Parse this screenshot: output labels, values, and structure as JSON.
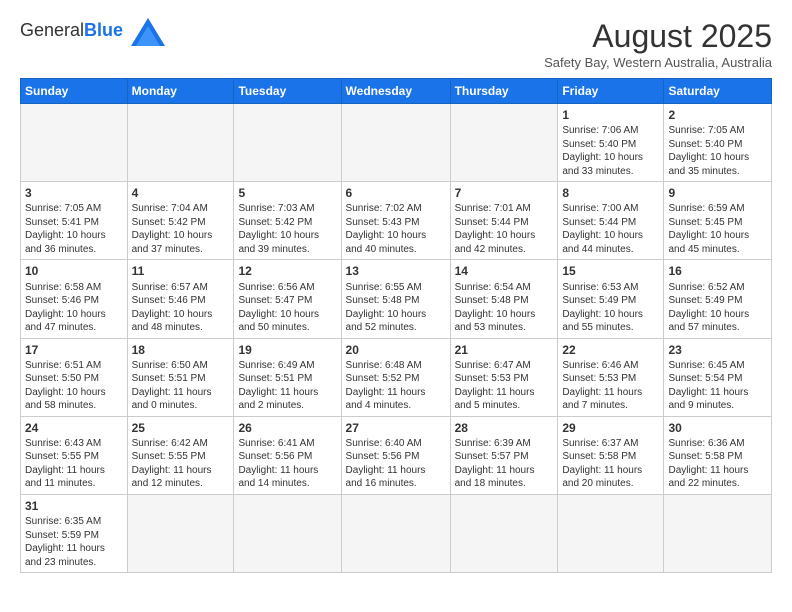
{
  "header": {
    "logo_general": "General",
    "logo_blue": "Blue",
    "month_title": "August 2025",
    "subtitle": "Safety Bay, Western Australia, Australia"
  },
  "weekdays": [
    "Sunday",
    "Monday",
    "Tuesday",
    "Wednesday",
    "Thursday",
    "Friday",
    "Saturday"
  ],
  "weeks": [
    [
      {
        "day": "",
        "info": ""
      },
      {
        "day": "",
        "info": ""
      },
      {
        "day": "",
        "info": ""
      },
      {
        "day": "",
        "info": ""
      },
      {
        "day": "",
        "info": ""
      },
      {
        "day": "1",
        "info": "Sunrise: 7:06 AM\nSunset: 5:40 PM\nDaylight: 10 hours\nand 33 minutes."
      },
      {
        "day": "2",
        "info": "Sunrise: 7:05 AM\nSunset: 5:40 PM\nDaylight: 10 hours\nand 35 minutes."
      }
    ],
    [
      {
        "day": "3",
        "info": "Sunrise: 7:05 AM\nSunset: 5:41 PM\nDaylight: 10 hours\nand 36 minutes."
      },
      {
        "day": "4",
        "info": "Sunrise: 7:04 AM\nSunset: 5:42 PM\nDaylight: 10 hours\nand 37 minutes."
      },
      {
        "day": "5",
        "info": "Sunrise: 7:03 AM\nSunset: 5:42 PM\nDaylight: 10 hours\nand 39 minutes."
      },
      {
        "day": "6",
        "info": "Sunrise: 7:02 AM\nSunset: 5:43 PM\nDaylight: 10 hours\nand 40 minutes."
      },
      {
        "day": "7",
        "info": "Sunrise: 7:01 AM\nSunset: 5:44 PM\nDaylight: 10 hours\nand 42 minutes."
      },
      {
        "day": "8",
        "info": "Sunrise: 7:00 AM\nSunset: 5:44 PM\nDaylight: 10 hours\nand 44 minutes."
      },
      {
        "day": "9",
        "info": "Sunrise: 6:59 AM\nSunset: 5:45 PM\nDaylight: 10 hours\nand 45 minutes."
      }
    ],
    [
      {
        "day": "10",
        "info": "Sunrise: 6:58 AM\nSunset: 5:46 PM\nDaylight: 10 hours\nand 47 minutes."
      },
      {
        "day": "11",
        "info": "Sunrise: 6:57 AM\nSunset: 5:46 PM\nDaylight: 10 hours\nand 48 minutes."
      },
      {
        "day": "12",
        "info": "Sunrise: 6:56 AM\nSunset: 5:47 PM\nDaylight: 10 hours\nand 50 minutes."
      },
      {
        "day": "13",
        "info": "Sunrise: 6:55 AM\nSunset: 5:48 PM\nDaylight: 10 hours\nand 52 minutes."
      },
      {
        "day": "14",
        "info": "Sunrise: 6:54 AM\nSunset: 5:48 PM\nDaylight: 10 hours\nand 53 minutes."
      },
      {
        "day": "15",
        "info": "Sunrise: 6:53 AM\nSunset: 5:49 PM\nDaylight: 10 hours\nand 55 minutes."
      },
      {
        "day": "16",
        "info": "Sunrise: 6:52 AM\nSunset: 5:49 PM\nDaylight: 10 hours\nand 57 minutes."
      }
    ],
    [
      {
        "day": "17",
        "info": "Sunrise: 6:51 AM\nSunset: 5:50 PM\nDaylight: 10 hours\nand 58 minutes."
      },
      {
        "day": "18",
        "info": "Sunrise: 6:50 AM\nSunset: 5:51 PM\nDaylight: 11 hours\nand 0 minutes."
      },
      {
        "day": "19",
        "info": "Sunrise: 6:49 AM\nSunset: 5:51 PM\nDaylight: 11 hours\nand 2 minutes."
      },
      {
        "day": "20",
        "info": "Sunrise: 6:48 AM\nSunset: 5:52 PM\nDaylight: 11 hours\nand 4 minutes."
      },
      {
        "day": "21",
        "info": "Sunrise: 6:47 AM\nSunset: 5:53 PM\nDaylight: 11 hours\nand 5 minutes."
      },
      {
        "day": "22",
        "info": "Sunrise: 6:46 AM\nSunset: 5:53 PM\nDaylight: 11 hours\nand 7 minutes."
      },
      {
        "day": "23",
        "info": "Sunrise: 6:45 AM\nSunset: 5:54 PM\nDaylight: 11 hours\nand 9 minutes."
      }
    ],
    [
      {
        "day": "24",
        "info": "Sunrise: 6:43 AM\nSunset: 5:55 PM\nDaylight: 11 hours\nand 11 minutes."
      },
      {
        "day": "25",
        "info": "Sunrise: 6:42 AM\nSunset: 5:55 PM\nDaylight: 11 hours\nand 12 minutes."
      },
      {
        "day": "26",
        "info": "Sunrise: 6:41 AM\nSunset: 5:56 PM\nDaylight: 11 hours\nand 14 minutes."
      },
      {
        "day": "27",
        "info": "Sunrise: 6:40 AM\nSunset: 5:56 PM\nDaylight: 11 hours\nand 16 minutes."
      },
      {
        "day": "28",
        "info": "Sunrise: 6:39 AM\nSunset: 5:57 PM\nDaylight: 11 hours\nand 18 minutes."
      },
      {
        "day": "29",
        "info": "Sunrise: 6:37 AM\nSunset: 5:58 PM\nDaylight: 11 hours\nand 20 minutes."
      },
      {
        "day": "30",
        "info": "Sunrise: 6:36 AM\nSunset: 5:58 PM\nDaylight: 11 hours\nand 22 minutes."
      }
    ],
    [
      {
        "day": "31",
        "info": "Sunrise: 6:35 AM\nSunset: 5:59 PM\nDaylight: 11 hours\nand 23 minutes."
      },
      {
        "day": "",
        "info": ""
      },
      {
        "day": "",
        "info": ""
      },
      {
        "day": "",
        "info": ""
      },
      {
        "day": "",
        "info": ""
      },
      {
        "day": "",
        "info": ""
      },
      {
        "day": "",
        "info": ""
      }
    ]
  ]
}
